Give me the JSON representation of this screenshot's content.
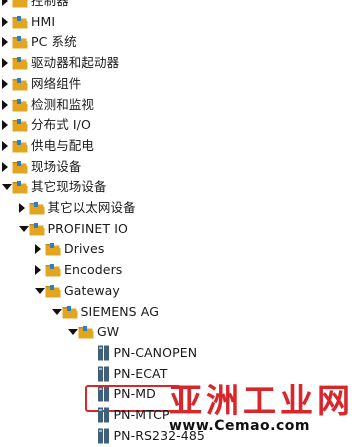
{
  "tree": {
    "items": [
      {
        "label": "控制器",
        "depth": 0,
        "state": "collapsed",
        "icon": "folder-icon"
      },
      {
        "label": "HMI",
        "depth": 0,
        "state": "collapsed",
        "icon": "folder-icon"
      },
      {
        "label": "PC 系统",
        "depth": 0,
        "state": "collapsed",
        "icon": "folder-icon"
      },
      {
        "label": "驱动器和起动器",
        "depth": 0,
        "state": "collapsed",
        "icon": "folder-icon"
      },
      {
        "label": "网络组件",
        "depth": 0,
        "state": "collapsed",
        "icon": "folder-icon"
      },
      {
        "label": "检测和监视",
        "depth": 0,
        "state": "collapsed",
        "icon": "folder-icon"
      },
      {
        "label": "分布式 I/O",
        "depth": 0,
        "state": "collapsed",
        "icon": "folder-icon"
      },
      {
        "label": "供电与配电",
        "depth": 0,
        "state": "collapsed",
        "icon": "folder-icon"
      },
      {
        "label": "现场设备",
        "depth": 0,
        "state": "collapsed",
        "icon": "folder-icon"
      },
      {
        "label": "其它现场设备",
        "depth": 0,
        "state": "expanded",
        "icon": "folder-icon"
      },
      {
        "label": "其它以太网设备",
        "depth": 1,
        "state": "collapsed",
        "icon": "folder-icon"
      },
      {
        "label": "PROFINET IO",
        "depth": 1,
        "state": "expanded",
        "icon": "folder-icon"
      },
      {
        "label": "Drives",
        "depth": 2,
        "state": "collapsed",
        "icon": "folder-icon"
      },
      {
        "label": "Encoders",
        "depth": 2,
        "state": "collapsed",
        "icon": "folder-icon"
      },
      {
        "label": "Gateway",
        "depth": 2,
        "state": "expanded",
        "icon": "folder-icon"
      },
      {
        "label": "SIEMENS AG",
        "depth": 3,
        "state": "expanded",
        "icon": "folder-icon"
      },
      {
        "label": "GW",
        "depth": 4,
        "state": "expanded",
        "icon": "folder-icon"
      },
      {
        "label": "PN-CANOPEN",
        "depth": 5,
        "state": "leaf",
        "icon": "device-module-icon"
      },
      {
        "label": "PN-ECAT",
        "depth": 5,
        "state": "leaf",
        "icon": "device-module-icon"
      },
      {
        "label": "PN-MD",
        "depth": 5,
        "state": "leaf",
        "icon": "device-module-icon",
        "highlighted": true
      },
      {
        "label": "PN-MTCP",
        "depth": 5,
        "state": "leaf",
        "icon": "device-module-icon"
      },
      {
        "label": "PN-RS232-485",
        "depth": 5,
        "state": "leaf",
        "icon": "device-module-icon"
      }
    ]
  },
  "colors": {
    "folder_body": "#e3a51f",
    "folder_tab": "#c98a12",
    "folder_page": "#2d7fc4",
    "device": "#3f5f7a",
    "highlight": "#d9262b",
    "watermark_red": "#d9262b"
  },
  "watermark": {
    "title": "亚洲工业网",
    "url": "www.Cemao.com"
  }
}
